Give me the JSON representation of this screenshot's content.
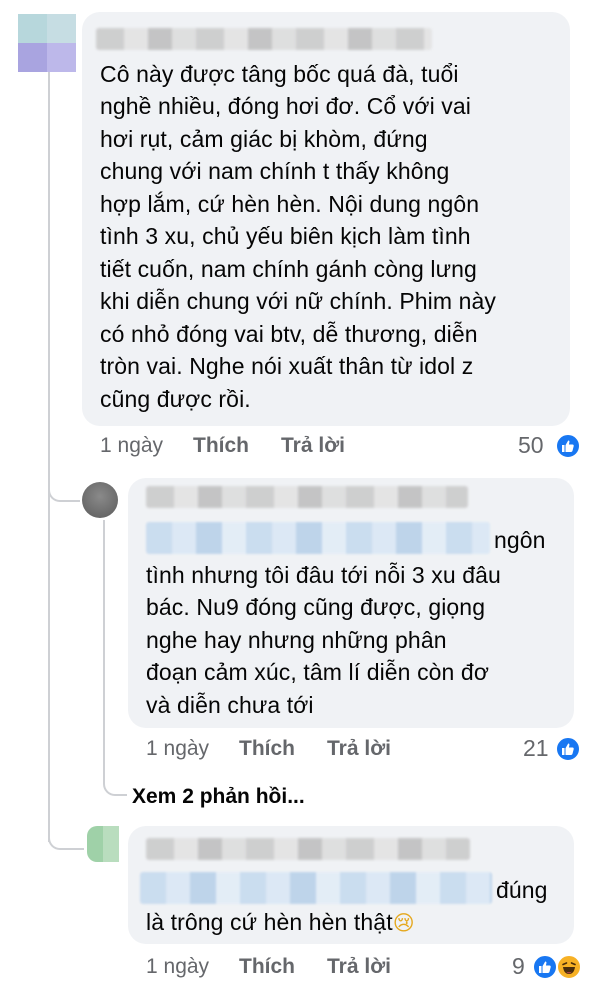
{
  "colors": {
    "bubble": "#f0f2f5",
    "meta": "#65676b",
    "like_blue": "#1877f2",
    "haha_yellow": "#f7b125"
  },
  "comments": [
    {
      "lines": [
        "Cô này được tâng bốc quá đà, tuổi",
        "nghề nhiều, đóng hơi đơ. Cổ với vai",
        "hơi rụt, cảm giác bị khòm, đứng",
        "chung với nam chính t thấy không",
        "hợp lắm, cứ hèn hèn. Nội dung ngôn",
        "tình 3 xu, chủ yếu biên kịch làm tình",
        "tiết cuốn, nam chính gánh còng lưng",
        "khi diễn chung với nữ chính. Phim này",
        "có nhỏ đóng vai btv, dễ thương, diễn",
        "tròn vai. Nghe nói xuất thân từ idol z",
        "cũng được rồi."
      ],
      "time": "1 ngày",
      "like": "Thích",
      "reply": "Trả lời",
      "reaction_count": "50",
      "reaction_icons": [
        "like-icon"
      ]
    },
    {
      "lines": [
        "ngôn",
        "tình nhưng tôi đâu tới nỗi 3 xu đâu",
        "bác. Nu9 đóng cũng được, giọng",
        "nghe hay nhưng những phân",
        "đoạn cảm xúc, tâm lí diễn còn đơ",
        "và diễn chưa tới"
      ],
      "time": "1 ngày",
      "like": "Thích",
      "reply": "Trả lời",
      "reaction_count": "21",
      "reaction_icons": [
        "like-icon"
      ]
    },
    {
      "lines": [
        "đúng",
        "là trông cứ hèn hèn thật"
      ],
      "emoji": "😢",
      "time": "1 ngày",
      "like": "Thích",
      "reply": "Trả lời",
      "reaction_count": "9",
      "reaction_icons": [
        "like-icon",
        "haha-icon"
      ]
    }
  ],
  "see_more": "Xem 2 phản hồi..."
}
